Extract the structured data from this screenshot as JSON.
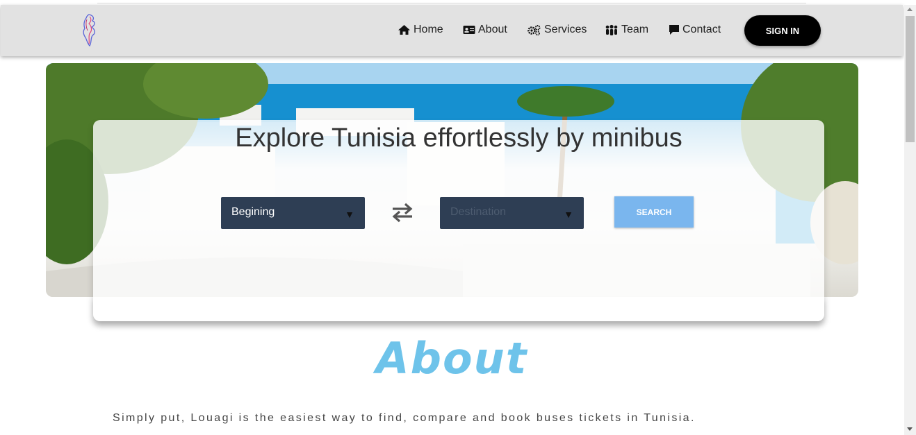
{
  "nav": {
    "items": [
      {
        "label": "Home",
        "icon": "home-icon"
      },
      {
        "label": "About",
        "icon": "id-card-icon"
      },
      {
        "label": "Services",
        "icon": "gears-icon"
      },
      {
        "label": "Team",
        "icon": "users-icon"
      },
      {
        "label": "Contact",
        "icon": "comment-icon"
      }
    ],
    "signin_label": "SIGN IN"
  },
  "hero": {
    "title": "Explore Tunisia effortlessly by minibus",
    "from_select": {
      "value": "Begining"
    },
    "to_select": {
      "placeholder": "Destination"
    },
    "search_label": "SEARCH"
  },
  "about": {
    "title": "About",
    "text": "Simply put, Louagi is the easiest way to find, compare and book buses tickets in Tunisia."
  },
  "colors": {
    "navbar": "#e2e2e2",
    "signin_bg": "#000000",
    "select_bg": "#2e3e54",
    "search_bg": "#7ab6ee",
    "about_title": "#6ec3ea"
  }
}
